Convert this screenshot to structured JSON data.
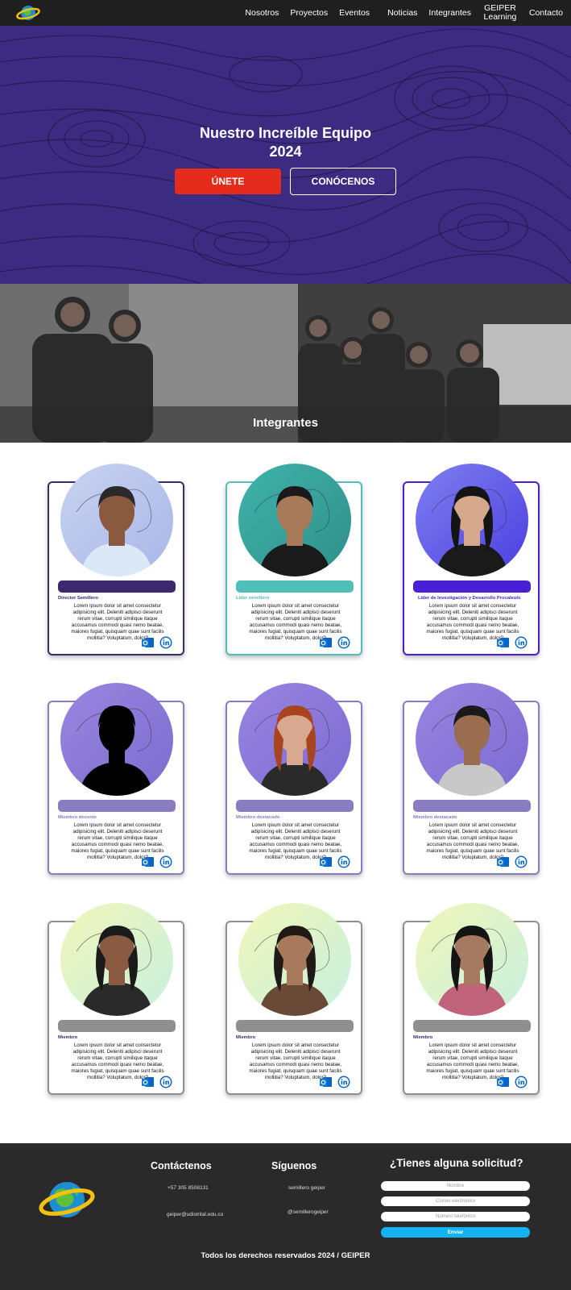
{
  "nav": {
    "items": [
      {
        "label": "Nosotros"
      },
      {
        "label": "Proyectos"
      },
      {
        "label": "Eventos"
      },
      {
        "label": "Noticias"
      },
      {
        "label": "Integrantes"
      },
      {
        "label": "GEIPER Learning",
        "line1": "GEIPER",
        "line2": "Learning"
      },
      {
        "label": "Contacto"
      }
    ]
  },
  "hero": {
    "title_line1": "Nuestro Increíble Equipo",
    "title_line2": "2024",
    "join_label": "ÚNETE",
    "know_label": "CONÓCENOS"
  },
  "banner": {
    "title": "Integrantes"
  },
  "members_common": {
    "description": "Lorem ipsum dolor sit amet consectetur adipisicing elit. Deleniti adipisci deserunt rerum vitae, corrupti similique itaque accusamus commodi quasi nemo beatae, maiores fugiat, quisquam quae sunt facilis mollitia? Voluptatum, dolor?"
  },
  "members": [
    {
      "role": "Director Semillero",
      "accent": "#3c2a6e"
    },
    {
      "role": "Líder semillero",
      "accent": "#4fbfb8"
    },
    {
      "role": "Líder de Investigación y Desarrollo Procaleulo",
      "accent": "#4a1fd6"
    },
    {
      "role": "Miembro docente",
      "accent": "#8a7cc0"
    },
    {
      "role": "Miembro destacado",
      "accent": "#8a7cc0"
    },
    {
      "role": "Miembro destacado",
      "accent": "#8a7cc0"
    },
    {
      "role": "Miembro",
      "accent": "#8f8f8f"
    },
    {
      "role": "Miembro",
      "accent": "#8f8f8f"
    },
    {
      "role": "Miembro",
      "accent": "#8f8f8f"
    }
  ],
  "footer": {
    "contact_title": "Contáctenos",
    "phone": "+57 305 8508131",
    "email": "geiper@udistrital.edu.co",
    "follow_title": "Síguenos",
    "facebook": "semillero geiper",
    "instagram": "@semillerogeiper",
    "form_title": "¿Tienes alguna solicitud?",
    "name_placeholder": "Nombre",
    "email_placeholder": "Correo electrónico",
    "phone_placeholder": "Número telefónico",
    "submit_label": "Enviar",
    "copyright": "Todos los derechos reservados 2024 / GEIPER"
  },
  "colors": {
    "nav_bg": "#1f1f1f",
    "hero_bg": "#3a2b80",
    "join_button": "#e52b1c",
    "footer_bg": "#2a2a2a",
    "submit_button": "#12b3f0"
  },
  "icons": [
    "globe-logo-icon",
    "outlook-icon",
    "linkedin-icon"
  ]
}
